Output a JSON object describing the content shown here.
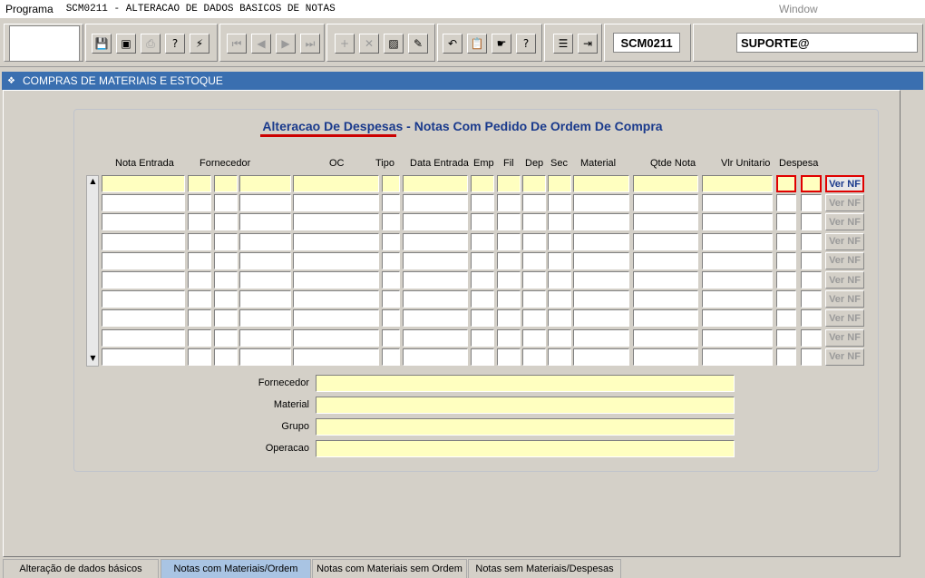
{
  "menubar": {
    "programa": "Programa",
    "title": "SCM0211 - ALTERACAO DE DADOS BASICOS DE NOTAS",
    "window": "Window"
  },
  "toolbar": {
    "program_code": "SCM0211",
    "user": "SUPORTE@",
    "buttons": [
      {
        "icon": "save-icon",
        "glyph": "💾"
      },
      {
        "icon": "screen-icon",
        "glyph": "▣"
      },
      {
        "icon": "print-icon",
        "glyph": "⎙"
      },
      {
        "icon": "query-icon",
        "glyph": "?"
      },
      {
        "icon": "execute-query-icon",
        "glyph": "⚡"
      },
      {
        "icon": "first-record-icon",
        "glyph": "⏮"
      },
      {
        "icon": "prev-record-icon",
        "glyph": "◀"
      },
      {
        "icon": "next-record-icon",
        "glyph": "▶"
      },
      {
        "icon": "last-record-icon",
        "glyph": "⏭"
      },
      {
        "icon": "insert-record-icon",
        "glyph": "+"
      },
      {
        "icon": "delete-record-icon",
        "glyph": "✕"
      },
      {
        "icon": "clear-record-icon",
        "glyph": "▨"
      },
      {
        "icon": "edit-icon",
        "glyph": "✎"
      },
      {
        "icon": "undo-icon",
        "glyph": "↶"
      },
      {
        "icon": "clipboard-icon",
        "glyph": "📋"
      },
      {
        "icon": "list-icon",
        "glyph": "☛"
      },
      {
        "icon": "help-icon",
        "glyph": "?"
      },
      {
        "icon": "menu-icon",
        "glyph": "☰"
      },
      {
        "icon": "exit-icon",
        "glyph": "⇥"
      }
    ]
  },
  "section_title": "COMPRAS DE MATERIAIS E ESTOQUE",
  "panel": {
    "title_link": "Alteracao De Despesas",
    "title_rest": " - Notas Com Pedido De Ordem De Compra"
  },
  "columns": [
    "Nota Entrada",
    "Fornecedor",
    "OC",
    "Tipo",
    "Data Entrada",
    "Emp",
    "Fil",
    "Dep",
    "Sec",
    "Material",
    "Qtde Nota",
    "Vlr Unitario",
    "Despesa"
  ],
  "row_count": 10,
  "ver_nf_label": "Ver NF",
  "details": [
    {
      "label": "Fornecedor",
      "value": ""
    },
    {
      "label": "Material",
      "value": ""
    },
    {
      "label": "Grupo",
      "value": ""
    },
    {
      "label": "Operacao",
      "value": ""
    }
  ],
  "tabs": [
    {
      "label": "Alteração de dados básicos",
      "active": false
    },
    {
      "label": "Notas com Materiais/Ordem",
      "active": true
    },
    {
      "label": "Notas com Materiais sem Ordem",
      "active": false
    },
    {
      "label": "Notas sem Materiais/Despesas",
      "active": false
    }
  ]
}
